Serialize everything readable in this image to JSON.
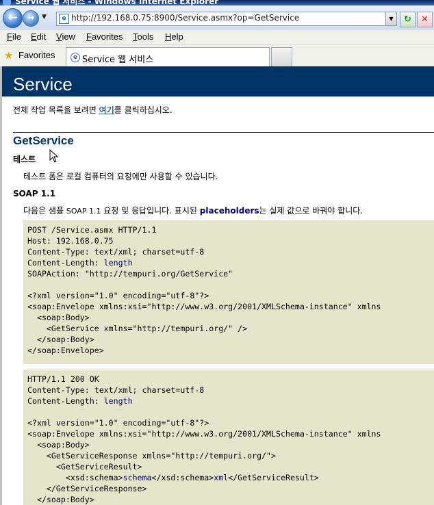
{
  "window": {
    "title": "Service 웹 서비스 - Windows Internet Explorer"
  },
  "nav": {
    "back_glyph": "←",
    "forward_glyph": "→",
    "address": "http://192.168.0.75:8900/Service.asmx?op=GetService",
    "dropdown_glyph": "▼",
    "refresh_glyph": "↻",
    "stop_glyph": "✕"
  },
  "menu": [
    {
      "key": "F",
      "rest": "ile"
    },
    {
      "key": "E",
      "rest": "dit"
    },
    {
      "key": "V",
      "rest": "iew"
    },
    {
      "key": "F",
      "rest": "avorites",
      "pre": ""
    },
    {
      "key": "T",
      "rest": "ools"
    },
    {
      "key": "H",
      "rest": "elp"
    }
  ],
  "favorites": {
    "label": "Favorites",
    "tab_title": "Service 웹 서비스"
  },
  "page": {
    "header": "Service",
    "intro_before": "전체 작업 목록을 보려면 ",
    "intro_link": "여기",
    "intro_after": "를 클릭하십시오.",
    "operation": "GetService",
    "test_heading": "테스트",
    "test_text": "테스트 폼은 로컬 컴퓨터의 요청에만 사용할 수 있습니다.",
    "soap_heading": "SOAP 1.1",
    "soap_before": "다음은 샘플 ",
    "soap_small": "SOAP 1.1",
    "soap_mid": " 요청 및 응답입니다. 표시된 ",
    "soap_placeholder": "placeholders",
    "soap_after": "는 실제 값으로 바꿔야 합니다.",
    "request": {
      "line1": "POST /Service.asmx HTTP/1.1",
      "line2": "Host: 192.168.0.75",
      "line3": "Content-Type: text/xml; charset=utf-8",
      "line4_label": "Content-Length: ",
      "line4_value": "length",
      "line5": "SOAPAction: \"http://tempuri.org/GetService\"",
      "line6": "",
      "line7": "<?xml version=\"1.0\" encoding=\"utf-8\"?>",
      "line8": "<soap:Envelope xmlns:xsi=\"http://www.w3.org/2001/XMLSchema-instance\" xmlns",
      "line9": "  <soap:Body>",
      "line10": "    <GetService xmlns=\"http://tempuri.org/\" />",
      "line11": "  </soap:Body>",
      "line12": "</soap:Envelope>"
    },
    "response": {
      "line1": "HTTP/1.1 200 OK",
      "line2": "Content-Type: text/xml; charset=utf-8",
      "line3_label": "Content-Length: ",
      "line3_value": "length",
      "line4": "",
      "line5": "<?xml version=\"1.0\" encoding=\"utf-8\"?>",
      "line6": "<soap:Envelope xmlns:xsi=\"http://www.w3.org/2001/XMLSchema-instance\" xmlns",
      "line7": "  <soap:Body>",
      "line8": "    <GetServiceResponse xmlns=\"http://tempuri.org/\">",
      "line9": "      <GetServiceResult>",
      "line10_pre": "        <xsd:schema>",
      "line10_val1": "schema",
      "line10_mid": "</xsd:schema>",
      "line10_val2": "xml",
      "line10_post": "</GetServiceResult>",
      "line11": "    </GetServiceResponse>",
      "line12": "  </soap:Body>"
    }
  }
}
